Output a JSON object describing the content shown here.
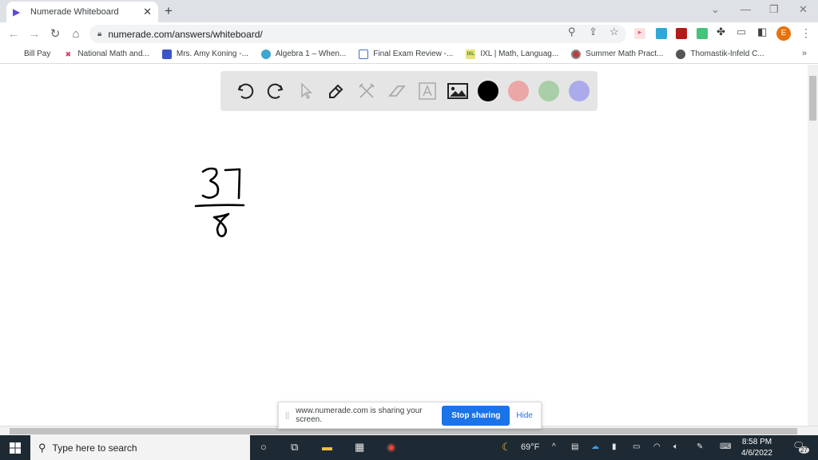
{
  "browser": {
    "tab": {
      "title": "Numerade Whiteboard",
      "close": "✕"
    },
    "new_tab": "+",
    "window_controls": {
      "tab_search": "⌄",
      "minimize": "—",
      "restore": "❐",
      "close": "✕"
    },
    "nav": {
      "back": "←",
      "forward": "→",
      "reload": "↻",
      "home": "⌂"
    },
    "url": "numerade.com/answers/whiteboard/",
    "profile_initial": "E",
    "bookmarks": [
      {
        "label": "Bill Pay"
      },
      {
        "label": "National Math and..."
      },
      {
        "label": "Mrs. Amy Koning -..."
      },
      {
        "label": "Algebra 1 – When..."
      },
      {
        "label": "Final Exam Review -..."
      },
      {
        "label": "IXL | Math, Languag..."
      },
      {
        "label": "Summer Math Pract..."
      },
      {
        "label": "Thomastik-Infeld C..."
      }
    ],
    "bookmarks_more": "»"
  },
  "whiteboard": {
    "tools": [
      "undo",
      "redo",
      "select",
      "pen",
      "tools",
      "eraser",
      "text",
      "image"
    ],
    "colors": [
      "#000000",
      "#eba6a6",
      "#a8cfa8",
      "#abaaea"
    ],
    "drawing": {
      "numerator": "37",
      "denominator": "8"
    }
  },
  "share_bar": {
    "message": "www.numerade.com is sharing your screen.",
    "stop_label": "Stop sharing",
    "hide_label": "Hide"
  },
  "taskbar": {
    "search_placeholder": "Type here to search",
    "weather": "69°F",
    "time": "8:58 PM",
    "date": "4/6/2022",
    "notifications": "27"
  }
}
